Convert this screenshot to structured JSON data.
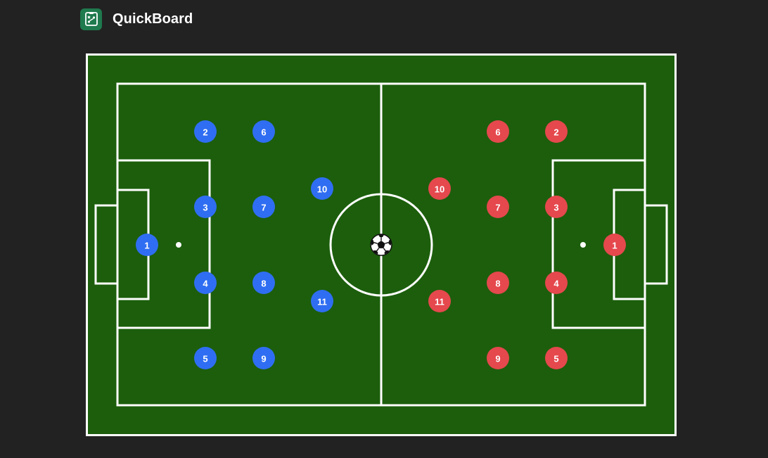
{
  "app": {
    "title": "QuickBoard",
    "logo_icon": "tactics-board-icon"
  },
  "colors": {
    "background": "#222222",
    "pitch": "#1c5e0c",
    "lines": "#ffffff",
    "team_home": "#2f6ef2",
    "team_away": "#e5484d"
  },
  "teams": [
    {
      "id": "home",
      "color": "#2f6ef2",
      "players": [
        "1",
        "2",
        "3",
        "4",
        "5",
        "6",
        "7",
        "8",
        "9",
        "10",
        "11"
      ]
    },
    {
      "id": "away",
      "color": "#e5484d",
      "players": [
        "1",
        "2",
        "3",
        "4",
        "5",
        "6",
        "7",
        "8",
        "9",
        "10",
        "11"
      ]
    }
  ],
  "ball": {
    "icon": "soccer-ball-icon"
  }
}
